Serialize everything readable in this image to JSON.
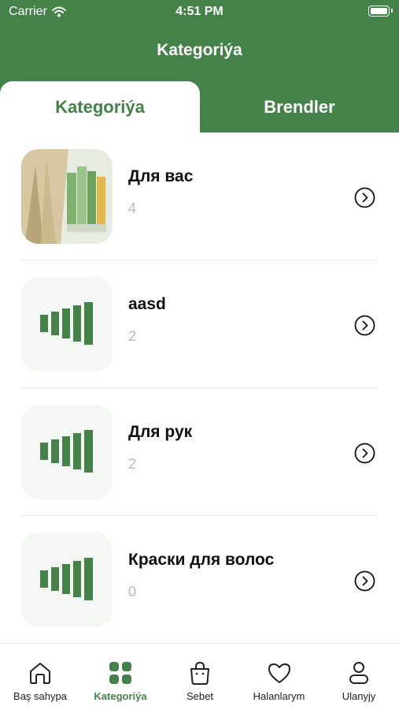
{
  "status_bar": {
    "carrier": "Carrier",
    "time": "4:51 PM"
  },
  "header": {
    "title": "Kategoriýa"
  },
  "tabs": [
    {
      "label": "Kategoriýa",
      "active": true
    },
    {
      "label": "Brendler",
      "active": false
    }
  ],
  "categories": [
    {
      "name": "Для вас",
      "count": "4",
      "thumbnail": "product-photo"
    },
    {
      "name": "aasd",
      "count": "2",
      "thumbnail": "placeholder-logo"
    },
    {
      "name": "Для рук",
      "count": "2",
      "thumbnail": "placeholder-logo"
    },
    {
      "name": "Краски для волос",
      "count": "0",
      "thumbnail": "placeholder-logo"
    }
  ],
  "tabbar": [
    {
      "label": "Baş sahypa",
      "icon": "home-icon"
    },
    {
      "label": "Kategoriýa",
      "icon": "grid-icon",
      "active": true
    },
    {
      "label": "Sebet",
      "icon": "bag-icon"
    },
    {
      "label": "Halanlarym",
      "icon": "heart-icon"
    },
    {
      "label": "Ulanyjy",
      "icon": "user-icon"
    }
  ],
  "colors": {
    "brand": "#45824a",
    "muted": "#b9b9b9"
  }
}
